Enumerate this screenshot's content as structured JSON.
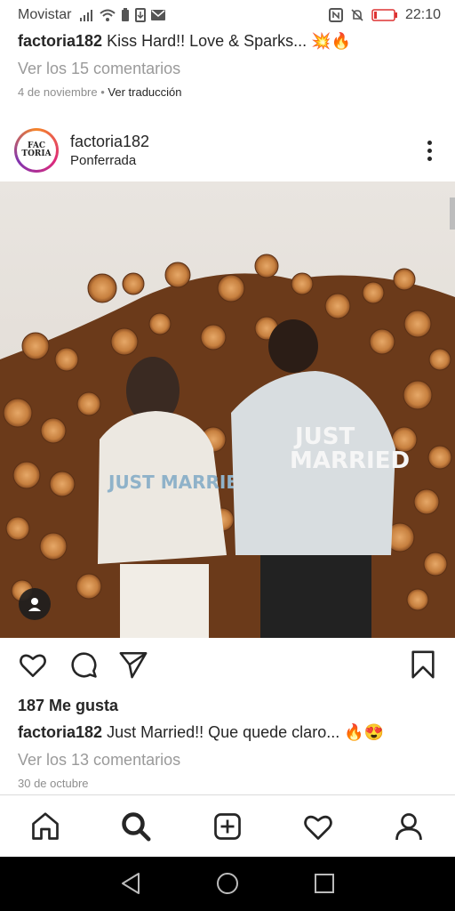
{
  "status_bar": {
    "carrier": "Movistar",
    "time": "22:10",
    "battery": "3"
  },
  "post_prev": {
    "username": "factoria182",
    "caption": "Kiss Hard!! Love & Sparks... 💥🔥",
    "comments_link": "Ver los 15 comentarios",
    "date": "4 de noviembre",
    "separator": " • ",
    "translate": "Ver traducción"
  },
  "post": {
    "avatar_text_1": "FAC",
    "avatar_text_2": "TORIA",
    "username": "factoria182",
    "location": "Ponferrada",
    "likes": "187 Me gusta",
    "caption_user": "factoria182",
    "caption": "Just Married!! Que quede claro... 🔥😍",
    "comments_link": "Ver los 13 comentarios",
    "date": "30 de octubre",
    "jacket_text_left": "JUST MARRIED",
    "jacket_text_right_1": "JUST",
    "jacket_text_right_2": "MARRIED"
  },
  "icons": {
    "like": "heart-icon",
    "comment": "comment-icon",
    "share": "send-icon",
    "save": "bookmark-icon",
    "home": "home-icon",
    "search": "search-icon",
    "new_post": "add-post-icon",
    "activity": "heart-icon",
    "profile": "profile-icon"
  },
  "colors": {
    "text": "#262626",
    "muted": "#8e8e8e",
    "border": "#dbdbdb",
    "sysnav": "#000000"
  }
}
